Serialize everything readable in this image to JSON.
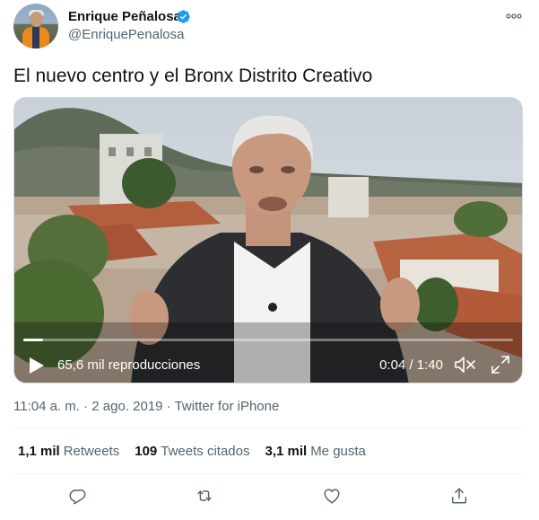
{
  "author": {
    "name": "Enrique Peñalosa",
    "handle": "@EnriquePenalosa",
    "verified_color": "#1d9bf0"
  },
  "tweet": {
    "text": "El nuevo centro y el Bronx Distrito Creativo"
  },
  "video": {
    "views": "65,6 mil reproducciones",
    "timecode": "0:04 / 1:40",
    "progress": 0.04
  },
  "meta": {
    "time": "11:04 a. m.",
    "separator1": " · ",
    "date": "2 ago. 2019",
    "separator2": " · ",
    "source": "Twitter for iPhone"
  },
  "stats": {
    "retweets_count": "1,1 mil",
    "retweets_label": "Retweets",
    "quotes_count": "109",
    "quotes_label": "Tweets citados",
    "likes_count": "3,1 mil",
    "likes_label": "Me gusta"
  },
  "icons": {
    "more": "more-icon",
    "verified": "verified-badge-icon",
    "play": "play-icon",
    "mute": "volume-muted-icon",
    "fullscreen": "fullscreen-icon",
    "reply": "reply-icon",
    "retweet": "retweet-icon",
    "like": "like-icon",
    "share": "share-icon"
  },
  "colors": {
    "text": "#0f1419",
    "secondary": "#536471",
    "accent": "#1d9bf0"
  }
}
